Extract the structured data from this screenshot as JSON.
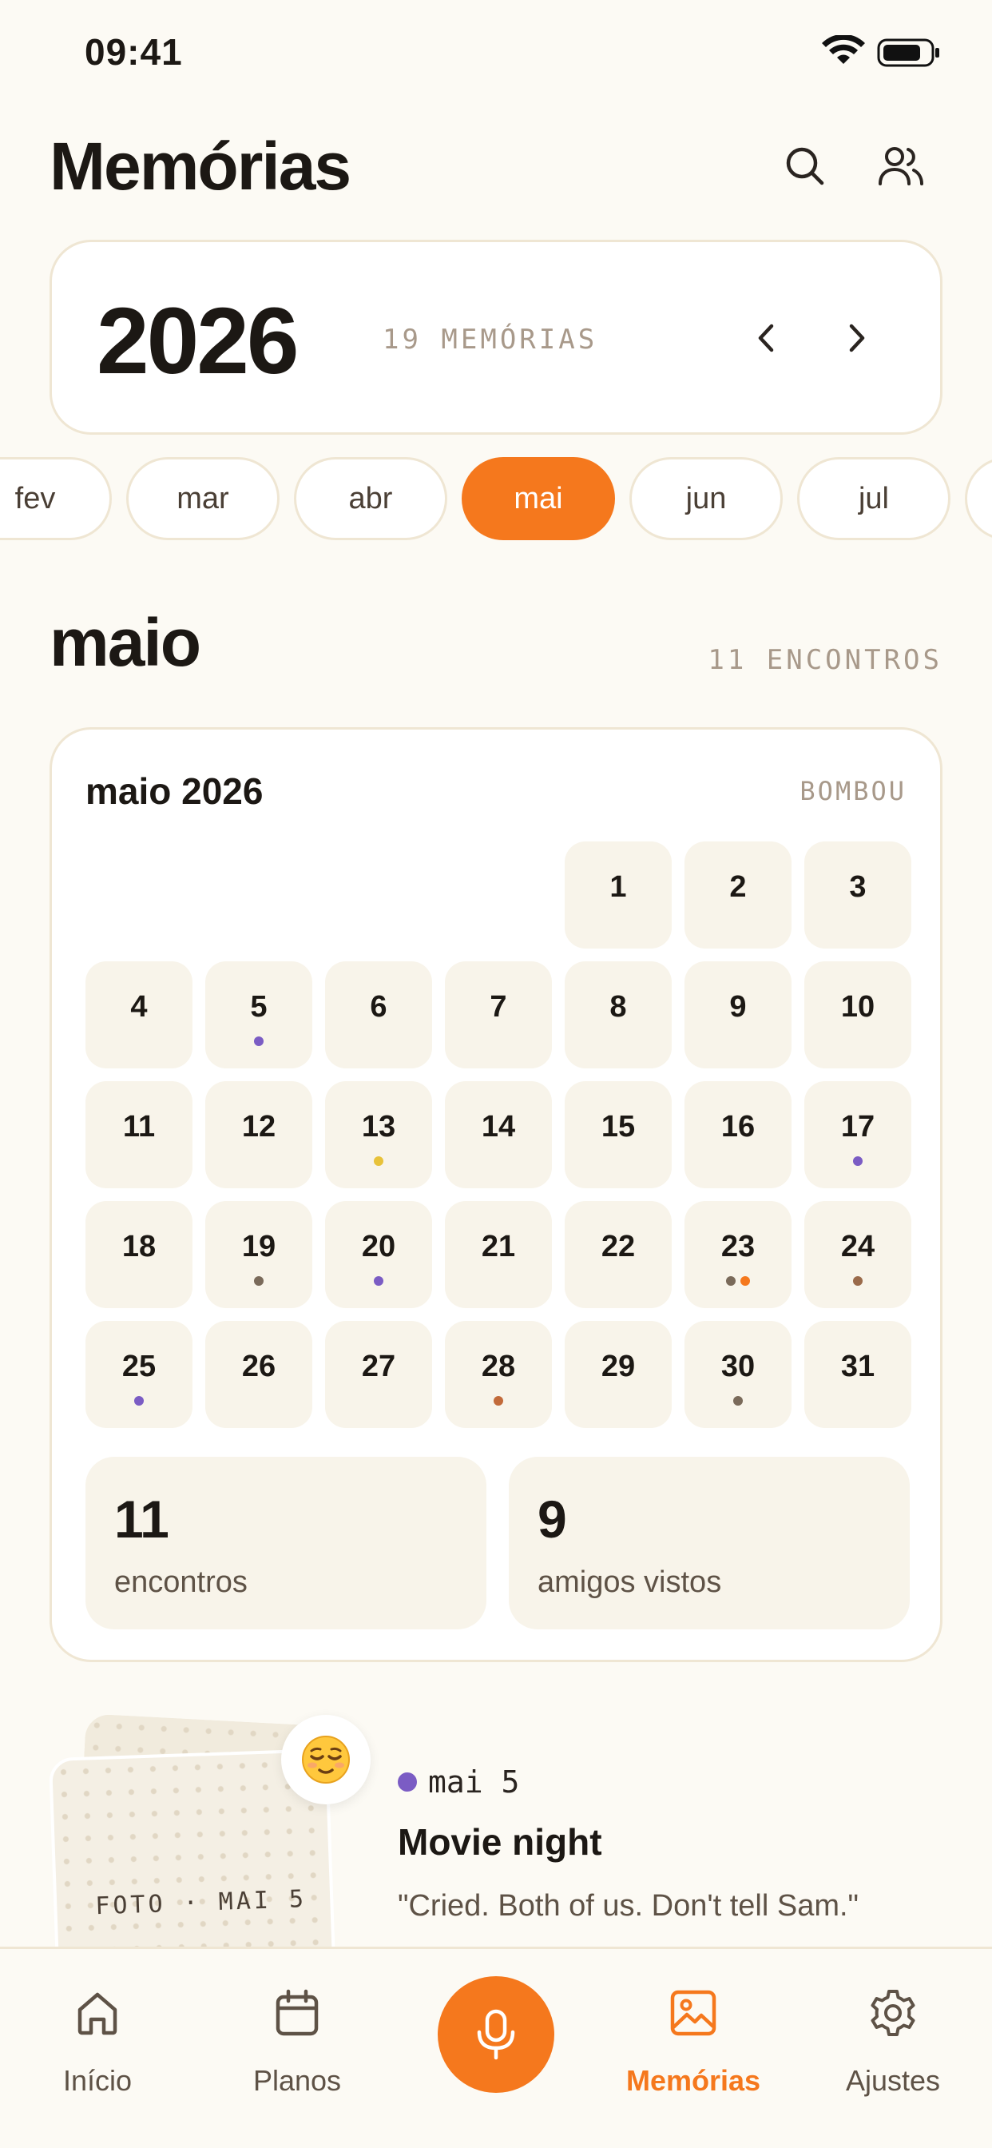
{
  "status": {
    "time": "09:41"
  },
  "header": {
    "title": "Memórias",
    "search_icon": "search-icon",
    "friends_icon": "users-icon"
  },
  "year_card": {
    "year": "2026",
    "count": "19 MEMÓRIAS"
  },
  "months": [
    "fev",
    "mar",
    "abr",
    "mai",
    "jun",
    "jul"
  ],
  "selected_month": "mai",
  "month_section": {
    "title": "maio",
    "count": "11 ENCONTROS"
  },
  "calendar": {
    "title": "maio 2026",
    "tag": "BOMBOU",
    "first_weekday_index": 4,
    "days": [
      {
        "n": "1",
        "dots": []
      },
      {
        "n": "2",
        "dots": []
      },
      {
        "n": "3",
        "dots": []
      },
      {
        "n": "4",
        "dots": []
      },
      {
        "n": "5",
        "dots": [
          "#7B5CC4"
        ]
      },
      {
        "n": "6",
        "dots": []
      },
      {
        "n": "7",
        "dots": []
      },
      {
        "n": "8",
        "dots": []
      },
      {
        "n": "9",
        "dots": []
      },
      {
        "n": "10",
        "dots": []
      },
      {
        "n": "11",
        "dots": []
      },
      {
        "n": "12",
        "dots": []
      },
      {
        "n": "13",
        "dots": [
          "#E8C23A"
        ]
      },
      {
        "n": "14",
        "dots": []
      },
      {
        "n": "15",
        "dots": []
      },
      {
        "n": "16",
        "dots": []
      },
      {
        "n": "17",
        "dots": [
          "#7B5CC4"
        ]
      },
      {
        "n": "18",
        "dots": []
      },
      {
        "n": "19",
        "dots": [
          "#7A6A5A"
        ]
      },
      {
        "n": "20",
        "dots": [
          "#7B5CC4"
        ]
      },
      {
        "n": "21",
        "dots": []
      },
      {
        "n": "22",
        "dots": []
      },
      {
        "n": "23",
        "dots": [
          "#7A6A5A",
          "#F5781D"
        ]
      },
      {
        "n": "24",
        "dots": [
          "#9A6A4A"
        ]
      },
      {
        "n": "25",
        "dots": [
          "#7B5CC4"
        ]
      },
      {
        "n": "26",
        "dots": []
      },
      {
        "n": "27",
        "dots": []
      },
      {
        "n": "28",
        "dots": [
          "#C26A3A"
        ]
      },
      {
        "n": "29",
        "dots": []
      },
      {
        "n": "30",
        "dots": [
          "#7A6A5A"
        ]
      },
      {
        "n": "31",
        "dots": []
      }
    ]
  },
  "stats": [
    {
      "value": "11",
      "label": "encontros"
    },
    {
      "value": "9",
      "label": "amigos vistos"
    }
  ],
  "memory": {
    "photo_label": "FOTO · MAI 5",
    "emoji": "😌",
    "date": "mai 5",
    "date_color": "#7B5CC4",
    "title": "Movie night",
    "quote": "\"Cried. Both of us. Don't tell Sam.\""
  },
  "tabs": [
    {
      "label": "Início",
      "icon": "home-icon"
    },
    {
      "label": "Planos",
      "icon": "calendar-icon"
    },
    {
      "label": "Memórias",
      "icon": "image-icon",
      "active": true
    },
    {
      "label": "Ajustes",
      "icon": "gear-icon"
    }
  ],
  "colors": {
    "accent": "#F5781D",
    "background": "#FCFAF4",
    "card_border": "#EFE6D3"
  }
}
